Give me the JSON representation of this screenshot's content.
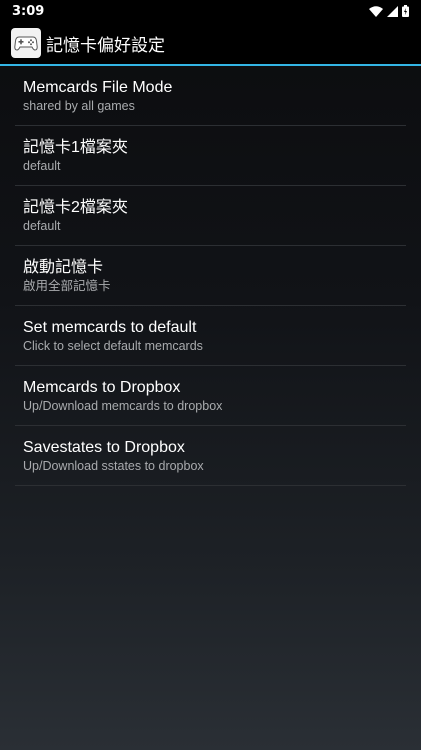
{
  "status_bar": {
    "time": "3:09"
  },
  "action_bar": {
    "app_icon": "gamepad-icon",
    "title": "記憶卡偏好設定",
    "accent_color": "#33b5e5"
  },
  "preferences": [
    {
      "title": "Memcards File Mode",
      "summary": "shared by all games"
    },
    {
      "title": "記憶卡1檔案夾",
      "summary": "default"
    },
    {
      "title": "記憶卡2檔案夾",
      "summary": "default"
    },
    {
      "title": "啟動記憶卡",
      "summary": "啟用全部記憶卡"
    },
    {
      "title": "Set memcards to default",
      "summary": "Click to select default memcards"
    },
    {
      "title": "Memcards to Dropbox",
      "summary": "Up/Download memcards to dropbox"
    },
    {
      "title": "Savestates to Dropbox",
      "summary": "Up/Download sstates to dropbox"
    }
  ]
}
